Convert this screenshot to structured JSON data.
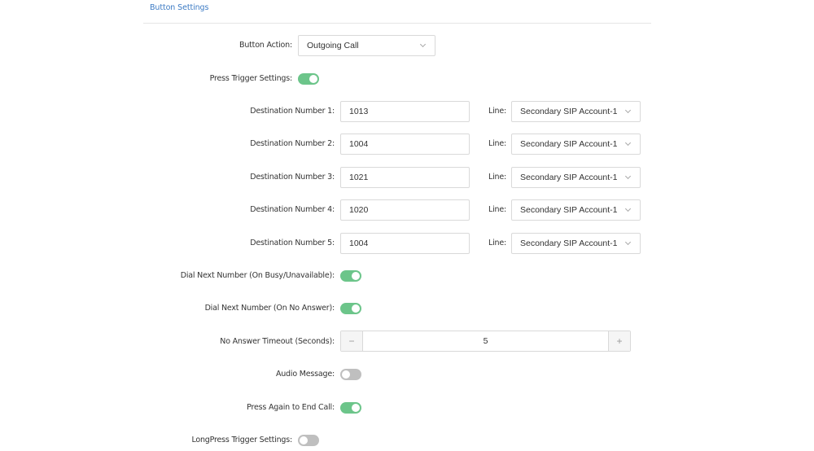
{
  "header": {
    "title": "Button Settings"
  },
  "button_action": {
    "label": "Button Action:",
    "value": "Outgoing Call"
  },
  "press_trigger": {
    "label": "Press Trigger Settings:",
    "on": true
  },
  "destinations": [
    {
      "label": "Destination Number 1:",
      "value": "1013",
      "line_label": "Line:",
      "line_value": "Secondary SIP Account-1"
    },
    {
      "label": "Destination Number 2:",
      "value": "1004",
      "line_label": "Line:",
      "line_value": "Secondary SIP Account-1"
    },
    {
      "label": "Destination Number 3:",
      "value": "1021",
      "line_label": "Line:",
      "line_value": "Secondary SIP Account-1"
    },
    {
      "label": "Destination Number 4:",
      "value": "1020",
      "line_label": "Line:",
      "line_value": "Secondary SIP Account-1"
    },
    {
      "label": "Destination Number 5:",
      "value": "1004",
      "line_label": "Line:",
      "line_value": "Secondary SIP Account-1"
    }
  ],
  "dial_next_busy": {
    "label": "Dial Next Number (On Busy/Unavailable):",
    "on": true
  },
  "dial_next_no_answer": {
    "label": "Dial Next Number (On No Answer):",
    "on": true
  },
  "no_answer_timeout": {
    "label": "No Answer Timeout (Seconds):",
    "value": "5",
    "minus": "−",
    "plus": "+"
  },
  "audio_message": {
    "label": "Audio Message:",
    "on": false
  },
  "press_again_end": {
    "label": "Press Again to End Call:",
    "on": true
  },
  "longpress_trigger": {
    "label": "LongPress Trigger Settings:",
    "on": false
  },
  "colors": {
    "accent_link": "#3d7bc4",
    "toggle_on": "#6cc58a",
    "toggle_off": "#bfbfbf"
  }
}
